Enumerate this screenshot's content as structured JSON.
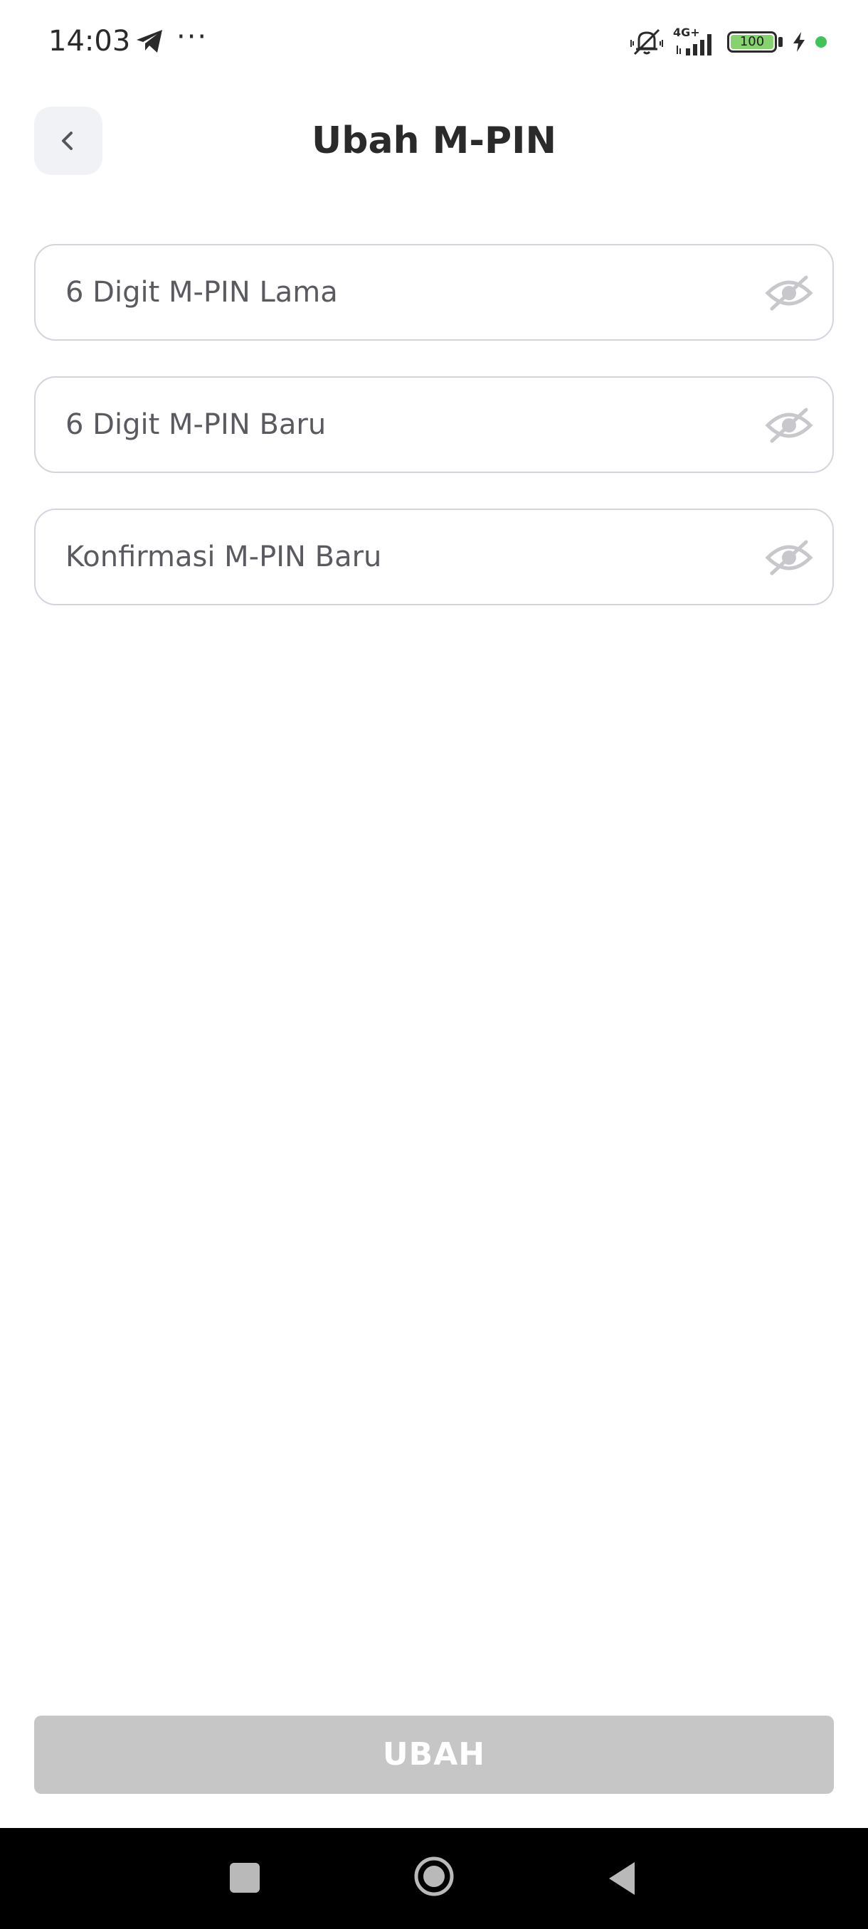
{
  "status_bar": {
    "time": "14:03",
    "more_indicator": "···",
    "network": "4G+",
    "battery_level": "100",
    "icons": [
      "telegram-icon",
      "vibrate-off-icon",
      "signal-icon",
      "battery-icon",
      "charging-icon"
    ]
  },
  "header": {
    "title": "Ubah M-PIN",
    "back_icon": "chevron-left-icon"
  },
  "form": {
    "fields": [
      {
        "placeholder": "6 Digit M-PIN Lama",
        "value": "",
        "toggle_icon": "eye-off-icon"
      },
      {
        "placeholder": "6 Digit M-PIN Baru",
        "value": "",
        "toggle_icon": "eye-off-icon"
      },
      {
        "placeholder": "Konfirmasi M-PIN Baru",
        "value": "",
        "toggle_icon": "eye-off-icon"
      }
    ],
    "submit_label": "UBAH",
    "submit_enabled": false
  },
  "navigation_bar": {
    "items": [
      "recents-button",
      "home-button",
      "back-button"
    ]
  },
  "colors": {
    "background": "#ffffff",
    "field_border": "#d4d4dd",
    "back_button_bg": "#f1f2f6",
    "disabled_button": "#c6c6c6",
    "battery_fill": "#86d26f",
    "status_dot": "#40c35a"
  }
}
